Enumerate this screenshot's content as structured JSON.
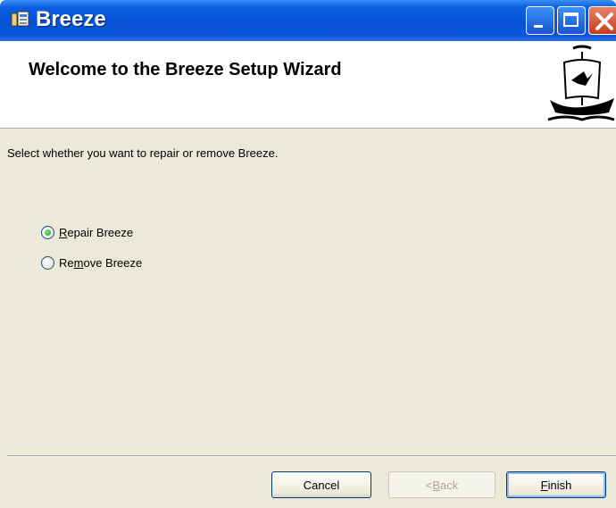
{
  "window": {
    "title": "Breeze",
    "colors": {
      "titlebar": "#0751d6",
      "close": "#c53d1b",
      "face": "#ece9d8",
      "banner": "#ffffff"
    }
  },
  "banner": {
    "title": "Welcome to the Breeze Setup Wizard",
    "logo_icon": "ship-logo-icon"
  },
  "main": {
    "instruction": "Select whether you want to repair or remove Breeze.",
    "options": [
      {
        "mnemonic": "R",
        "rest": "epair Breeze",
        "checked": true
      },
      {
        "before": "Re",
        "mnemonic": "m",
        "rest": "ove Breeze",
        "checked": false
      }
    ]
  },
  "buttons": {
    "cancel": "Cancel",
    "back_prefix": "< ",
    "back_mnemonic": "B",
    "back_rest": "ack",
    "finish_mnemonic": "F",
    "finish_rest": "inish"
  }
}
